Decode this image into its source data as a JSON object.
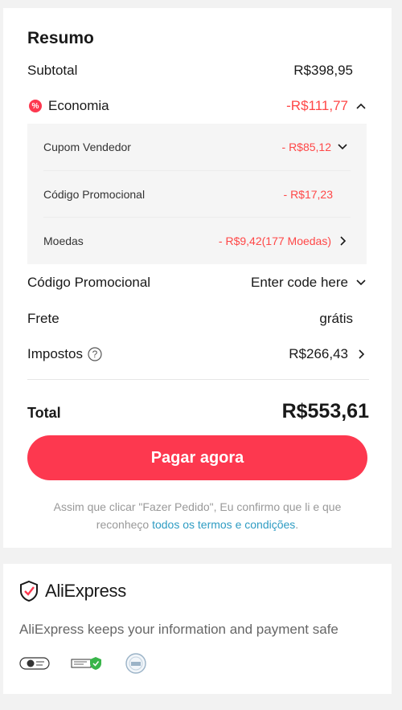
{
  "summary": {
    "title": "Resumo",
    "subtotal_label": "Subtotal",
    "subtotal_value": "R$398,95",
    "savings_icon": "percent-badge-icon",
    "savings_label": "Economia",
    "savings_value": "-R$111,77",
    "savings_items": [
      {
        "label": "Cupom Vendedor",
        "value": "- R$85,12",
        "icon": "chevron-down-icon"
      },
      {
        "label": "Código Promocional",
        "value": "- R$17,23",
        "icon": ""
      },
      {
        "label": "Moedas",
        "value": "- R$9,42(177 Moedas)",
        "icon": "chevron-right-icon"
      }
    ],
    "promo_label": "Código Promocional",
    "promo_placeholder": "Enter code here",
    "shipping_label": "Frete",
    "shipping_value": "grátis",
    "taxes_label": "Impostos",
    "taxes_value": "R$266,43",
    "total_label": "Total",
    "total_value": "R$553,61",
    "pay_button": "Pagar agora",
    "disclaimer_text": "Assim que clicar \"Fazer Pedido\", Eu confirmo que li e que reconheço ",
    "disclaimer_link": "todos os termos e condições",
    "disclaimer_end": "."
  },
  "security": {
    "brand": "AliExpress",
    "brand_icon": "shield-check-icon",
    "text": "AliExpress keeps your information and payment safe",
    "badges": [
      "security-badge-1-icon",
      "security-badge-2-icon",
      "security-badge-3-icon"
    ]
  },
  "colors": {
    "accent": "#fd384f",
    "discount": "#ff4747",
    "link": "#2e9cc3"
  }
}
